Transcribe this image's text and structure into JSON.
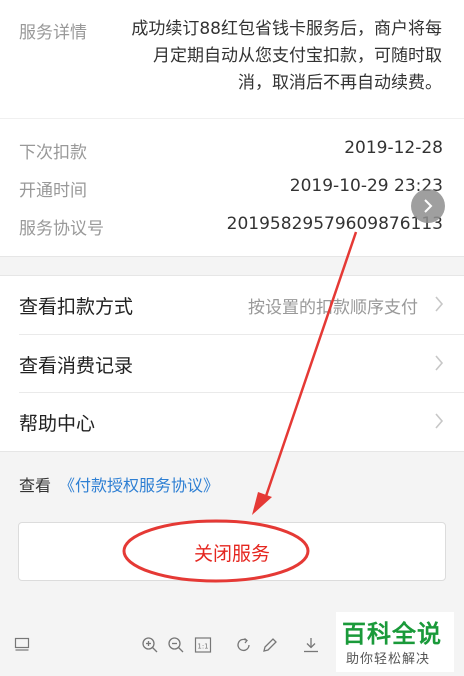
{
  "service": {
    "detail_label": "服务详情",
    "detail_text": "成功续订88红包省钱卡服务后，商户将每月定期自动从您支付宝扣款，可随时取消，取消后不再自动续费。"
  },
  "info": {
    "next_charge_label": "下次扣款",
    "next_charge_value": "2019-12-28",
    "open_time_label": "开通时间",
    "open_time_value": "2019-10-29 23:23",
    "agreement_no_label": "服务协议号",
    "agreement_no_value": "2019582957960987​6113"
  },
  "menu": {
    "items": [
      {
        "label": "查看扣款方式",
        "value": "按设置的扣款顺序支付"
      },
      {
        "label": "查看消费记录",
        "value": ""
      },
      {
        "label": "帮助中心",
        "value": ""
      }
    ]
  },
  "agreement": {
    "prefix": "查看",
    "link": "《付款授权服务协议》"
  },
  "close_button": {
    "label": "关闭服务"
  },
  "toolbar": {
    "icons": [
      "layout-icon",
      "zoom-in-icon",
      "zoom-out-icon",
      "actual-size-icon",
      "rotate-icon",
      "edit-icon",
      "download-icon"
    ],
    "actual_size_text": "1:1"
  },
  "watermark": {
    "title": "百科全说",
    "subtitle": "助你轻松解决"
  },
  "colors": {
    "link": "#2e7fd3",
    "danger": "#e5261f",
    "annotation": "#e53935",
    "watermark": "#1a9a3a"
  }
}
